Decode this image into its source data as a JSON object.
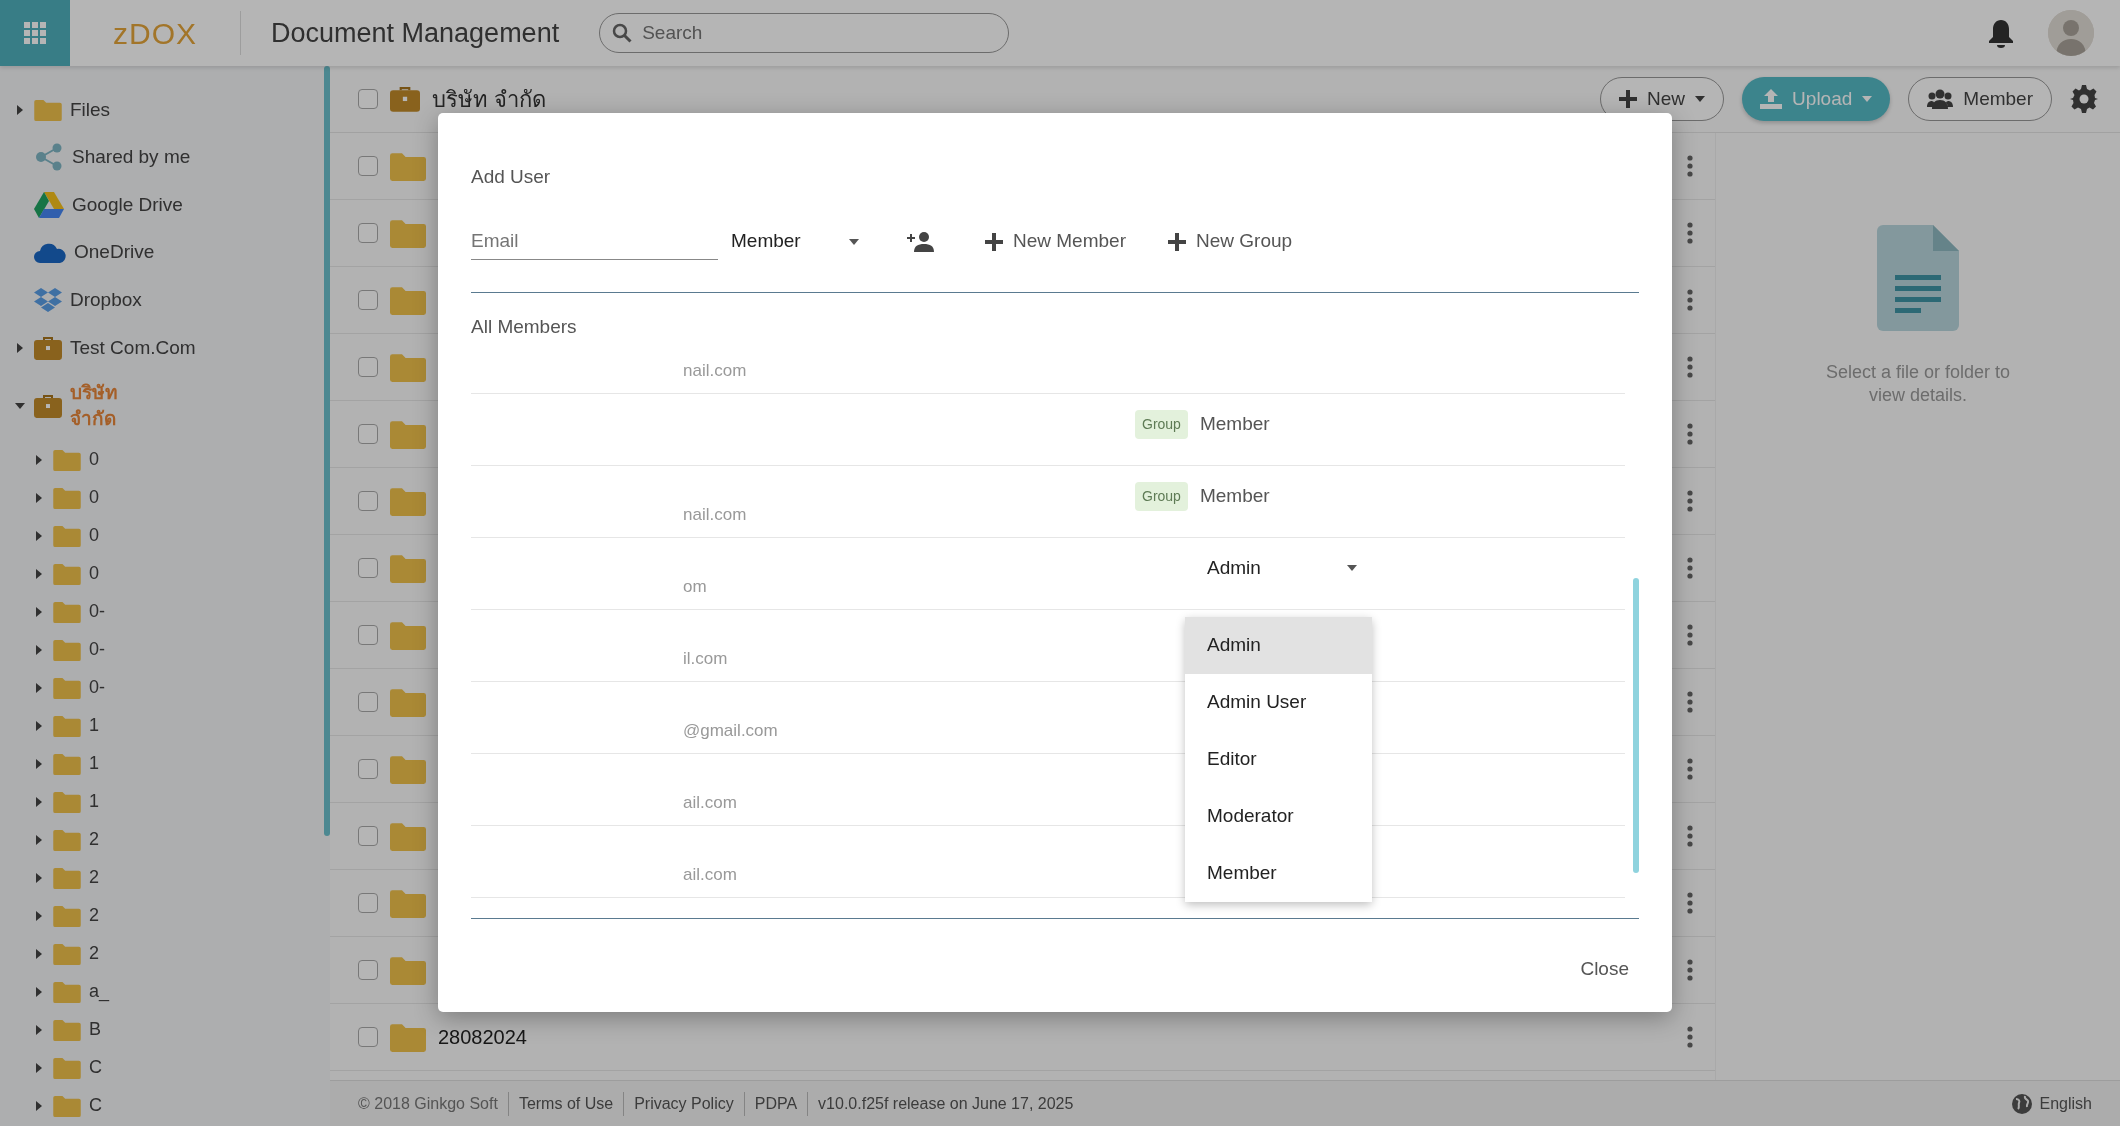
{
  "topbar": {
    "logo": "zDOX",
    "title": "Document Management",
    "search": {
      "placeholder": "Search"
    }
  },
  "sidebar": {
    "items": [
      {
        "label": "Files",
        "kind": "folder",
        "expandable": true,
        "expanded": false,
        "selected": false
      },
      {
        "label": "Shared by me",
        "kind": "share",
        "expandable": false,
        "expanded": false,
        "selected": false
      },
      {
        "label": "Google Drive",
        "kind": "gdrive",
        "expandable": false,
        "expanded": false,
        "selected": false
      },
      {
        "label": "OneDrive",
        "kind": "onedrive",
        "expandable": false,
        "expanded": false,
        "selected": false
      },
      {
        "label": "Dropbox",
        "kind": "dropbox",
        "expandable": false,
        "expanded": false,
        "selected": false
      },
      {
        "label": "Test Com.Com",
        "kind": "briefcase",
        "expandable": true,
        "expanded": false,
        "selected": false
      },
      {
        "label": "บริษัท จำกัด",
        "kind": "briefcase",
        "expandable": true,
        "expanded": true,
        "selected": true,
        "children": [
          {
            "label": "0",
            "kind": "folder",
            "expandable": true,
            "expanded": false,
            "selected": false
          },
          {
            "label": "0",
            "kind": "folder",
            "expandable": true,
            "expanded": false,
            "selected": false
          },
          {
            "label": "0",
            "kind": "folder",
            "expandable": true,
            "expanded": false,
            "selected": false
          },
          {
            "label": "0",
            "kind": "folder",
            "expandable": true,
            "expanded": false,
            "selected": false
          },
          {
            "label": "0-",
            "kind": "folder",
            "expandable": true,
            "expanded": false,
            "selected": false
          },
          {
            "label": "0-",
            "kind": "folder",
            "expandable": true,
            "expanded": false,
            "selected": false
          },
          {
            "label": "0-",
            "kind": "folder",
            "expandable": true,
            "expanded": false,
            "selected": false
          },
          {
            "label": "1",
            "kind": "folder",
            "expandable": true,
            "expanded": false,
            "selected": false
          },
          {
            "label": "1",
            "kind": "folder",
            "expandable": true,
            "expanded": false,
            "selected": false
          },
          {
            "label": "1",
            "kind": "folder",
            "expandable": true,
            "expanded": false,
            "selected": false
          },
          {
            "label": "2",
            "kind": "folder",
            "expandable": true,
            "expanded": false,
            "selected": false
          },
          {
            "label": "2",
            "kind": "folder",
            "expandable": true,
            "expanded": false,
            "selected": false
          },
          {
            "label": "2",
            "kind": "folder",
            "expandable": true,
            "expanded": false,
            "selected": false
          },
          {
            "label": "2",
            "kind": "folder",
            "expandable": true,
            "expanded": false,
            "selected": false
          },
          {
            "label": "a_",
            "kind": "folder",
            "expandable": true,
            "expanded": false,
            "selected": false
          },
          {
            "label": "B",
            "kind": "folder",
            "expandable": true,
            "expanded": false,
            "selected": false
          },
          {
            "label": "C",
            "kind": "folder",
            "expandable": true,
            "expanded": false,
            "selected": false
          },
          {
            "label": "C",
            "kind": "folder",
            "expandable": true,
            "expanded": false,
            "selected": false
          }
        ]
      }
    ]
  },
  "toolbar": {
    "checked": false,
    "title": "บริษัท จำกัด",
    "buttons": [
      {
        "label": "New",
        "kind": "outline",
        "caret": true
      },
      {
        "label": "Upload",
        "kind": "primary",
        "caret": true
      },
      {
        "label": "Member",
        "kind": "outline",
        "caret": false
      }
    ]
  },
  "file_rows": [
    {
      "checked": false
    },
    {
      "checked": false
    },
    {
      "checked": false
    },
    {
      "checked": false
    },
    {
      "checked": false
    },
    {
      "checked": false
    },
    {
      "checked": false
    },
    {
      "checked": false
    },
    {
      "checked": false
    },
    {
      "checked": false
    },
    {
      "checked": false
    },
    {
      "checked": false
    },
    {
      "checked": false
    },
    {
      "checked": false,
      "name": "28082024"
    }
  ],
  "details": {
    "message": "Select a file or folder to view details."
  },
  "footer": {
    "copyright": "© 2018 Ginkgo Soft",
    "links": [
      "Terms of Use",
      "Privacy Policy",
      "PDPA"
    ],
    "version": "v10.0.f25f release on June 17, 2025",
    "language": "English"
  },
  "dialog": {
    "title": "Add User",
    "email": {
      "placeholder": "Email"
    },
    "role": "Member",
    "actions": [
      "New Member",
      "New Group"
    ],
    "section": "All Members",
    "members": [
      {
        "email": "nail.com"
      },
      {
        "badge": "Group",
        "role": "Member",
        "kind": "text"
      },
      {
        "email": "nail.com",
        "badge": "Group",
        "role": "Member",
        "kind": "text"
      },
      {
        "email": "om",
        "role": "Admin",
        "kind": "select"
      },
      {
        "email": "il.com"
      },
      {
        "email": "@gmail.com"
      },
      {
        "email": "ail.com"
      },
      {
        "email": "ail.com"
      }
    ],
    "role_menu": [
      {
        "label": "Admin",
        "selected": true
      },
      {
        "label": "Admin User",
        "selected": false
      },
      {
        "label": "Editor",
        "selected": false
      },
      {
        "label": "Moderator",
        "selected": false
      },
      {
        "label": "Member",
        "selected": false
      }
    ],
    "close": "Close"
  }
}
